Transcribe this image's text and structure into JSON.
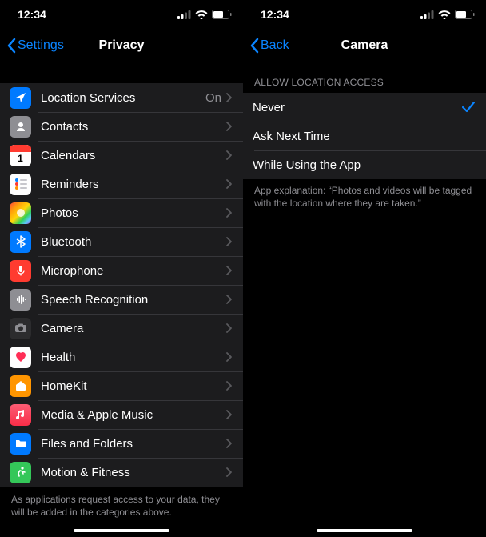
{
  "status": {
    "time": "12:34"
  },
  "left": {
    "back": "Settings",
    "title": "Privacy",
    "rows": [
      {
        "id": "location-services",
        "label": "Location Services",
        "value": "On"
      },
      {
        "id": "contacts",
        "label": "Contacts"
      },
      {
        "id": "calendars",
        "label": "Calendars"
      },
      {
        "id": "reminders",
        "label": "Reminders"
      },
      {
        "id": "photos",
        "label": "Photos"
      },
      {
        "id": "bluetooth",
        "label": "Bluetooth"
      },
      {
        "id": "microphone",
        "label": "Microphone"
      },
      {
        "id": "speech",
        "label": "Speech Recognition"
      },
      {
        "id": "camera",
        "label": "Camera"
      },
      {
        "id": "health",
        "label": "Health"
      },
      {
        "id": "homekit",
        "label": "HomeKit"
      },
      {
        "id": "media",
        "label": "Media & Apple Music"
      },
      {
        "id": "files",
        "label": "Files and Folders"
      },
      {
        "id": "motion",
        "label": "Motion & Fitness"
      }
    ],
    "footer": "As applications request access to your data, they will be added in the categories above."
  },
  "right": {
    "back": "Back",
    "title": "Camera",
    "section_header": "ALLOW LOCATION ACCESS",
    "options": [
      {
        "id": "never",
        "label": "Never",
        "selected": true
      },
      {
        "id": "ask",
        "label": "Ask Next Time",
        "selected": false
      },
      {
        "id": "while",
        "label": "While Using the App",
        "selected": false
      }
    ],
    "footer": "App explanation: “Photos and videos will be tagged with the location where they are taken.”"
  }
}
